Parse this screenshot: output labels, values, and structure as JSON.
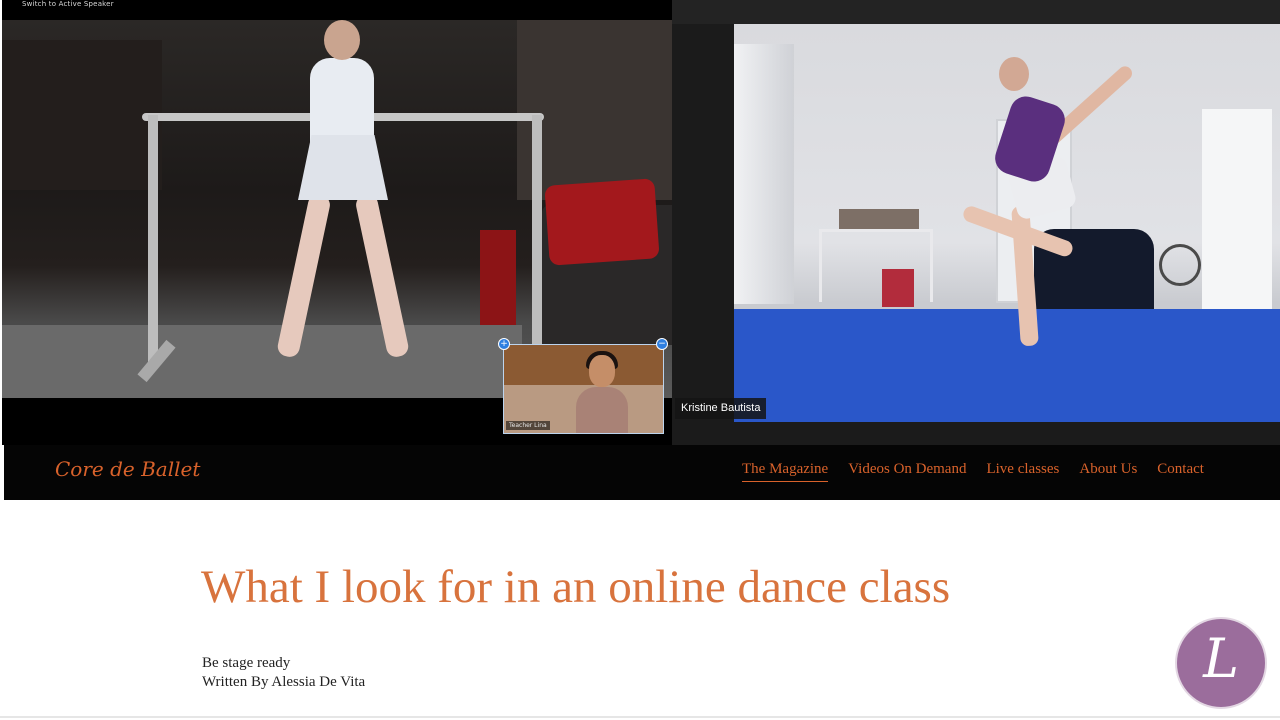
{
  "video_call": {
    "left_tile_caption": "Switch to Active Speaker",
    "pip_label": "Teacher Lina",
    "right_tile_name": "Kristine Bautista"
  },
  "site": {
    "logo_text": "Core de Ballet",
    "nav": [
      "The Magazine",
      "Videos On Demand",
      "Live classes",
      "About Us",
      "Contact"
    ],
    "active_nav": "The Magazine",
    "accent_color": "#d9622b"
  },
  "article": {
    "title": "What I look for in an online dance class",
    "subtitle": "Be stage ready",
    "byline": "Written By Alessia De Vita"
  },
  "badge": {
    "letter": "L",
    "color": "#9b6d9c"
  }
}
